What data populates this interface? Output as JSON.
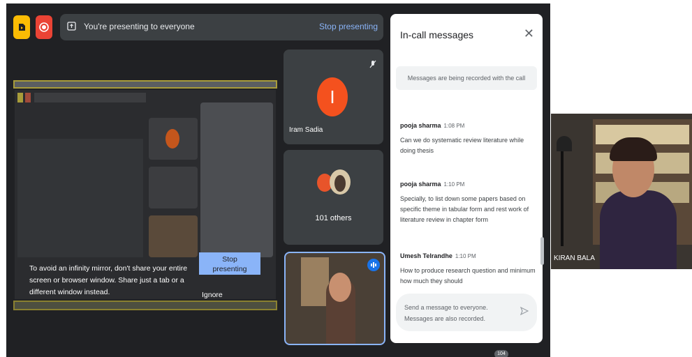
{
  "presenting_bar": {
    "text": "You're presenting to everyone",
    "stop_label": "Stop presenting"
  },
  "tiles": {
    "iram": {
      "name": "Iram Sadia",
      "initial": "I",
      "avatar_color": "#f4511e"
    },
    "others": {
      "label": "101 others"
    }
  },
  "infinity_warning": {
    "text": "To avoid an infinity mirror, don't share your entire screen or browser window. Share just a tab or a different window instead.",
    "stop_button": "Stop\npresenting",
    "ignore_button": "Ignore"
  },
  "chat": {
    "title": "In-call messages",
    "recording_notice": "Messages are being recorded with the call",
    "messages": [
      {
        "sender": "pooja sharma",
        "time": "1:08 PM",
        "text": "Can we do systematic review literature while doing thesis"
      },
      {
        "sender": "pooja sharma",
        "time": "1:10 PM",
        "text": "Specially, to list down some papers based on specific theme in tabular form and rest work of literature review in chapter form"
      },
      {
        "sender": "Umesh Telrandhe",
        "time": "1:10 PM",
        "text": "How to produce research question and minimum how much they should"
      }
    ],
    "compose_placeholder": "Send a message to everyone. Messages are also recorded."
  },
  "self_view": {
    "name": "KIRAN BALA"
  },
  "participant_count": "104",
  "colors": {
    "accent_blue": "#8ab4f8",
    "meet_dark": "#202124",
    "tile_gray": "#3c4043",
    "yellow": "#fbbc04",
    "red": "#ea4335"
  }
}
